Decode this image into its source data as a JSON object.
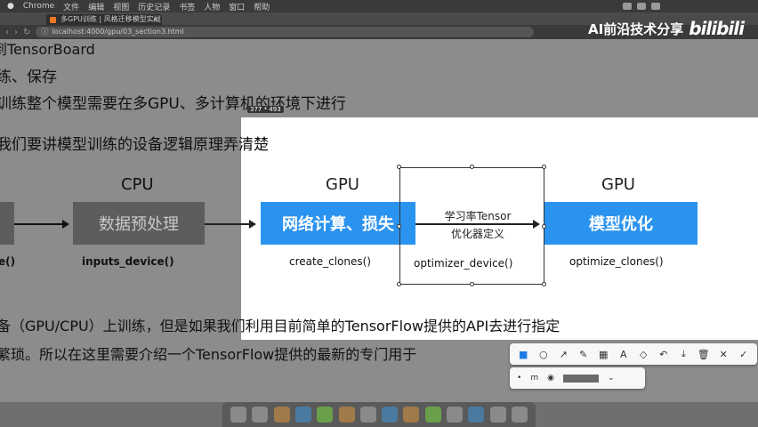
{
  "menubar": {
    "apple": "",
    "app": "Chrome",
    "items": [
      "文件",
      "编辑",
      "视图",
      "历史记录",
      "书签",
      "人物",
      "窗口",
      "帮助"
    ]
  },
  "browser": {
    "tab_title": "多GPU训练 | 风格迁移模型实战",
    "tab_close": "×",
    "back": "‹",
    "forward": "›",
    "reload": "↻",
    "url": "localhost:4000/gpu/03_section3.html"
  },
  "watermark": {
    "text": "AI前沿技术分享",
    "logo": "bilibili"
  },
  "notebook": {
    "line1": "到TensorBoard",
    "line2": "练、保存",
    "line3": "训练整个模型需要在多GPU、多计算机的环境下进行",
    "line4": "我们要讲模型训练的设备逻辑原理弄清楚",
    "line5": "备（GPU/CPU）上训练，但是如果我们利用目前简单的TensorFlow提供的API去进行指定",
    "line6": "繁琐。所以在这里需要介绍一个TensorFlow提供的最新的专门用于"
  },
  "selection": {
    "size_label": "377 * 493"
  },
  "diagram": {
    "cpu_header": "CPU",
    "gpu_header_left": "GPU",
    "gpu_header_right": "GPU",
    "box_preprocess": "数据预处理",
    "box_network": "网络计算、损失",
    "box_optimize": "模型优化",
    "mid_label_1": "学习率Tensor",
    "mid_label_2": "优化器定义",
    "fn_left_cut": "e()",
    "fn_inputs": "inputs_device()",
    "fn_create": "create_clones()",
    "fn_optimizer": "optimizer_device()",
    "fn_optimize": "optimize_clones()"
  },
  "toolbar": {
    "tools": [
      {
        "name": "rectangle-tool",
        "glyph": "■"
      },
      {
        "name": "ellipse-tool",
        "glyph": "○"
      },
      {
        "name": "arrow-tool",
        "glyph": "↗"
      },
      {
        "name": "pen-tool",
        "glyph": "✎"
      },
      {
        "name": "mosaic-tool",
        "glyph": "▦"
      },
      {
        "name": "text-tool",
        "glyph": "A"
      },
      {
        "name": "eraser-tool",
        "glyph": "◇"
      },
      {
        "name": "undo-tool",
        "glyph": "↶"
      },
      {
        "name": "download-tool",
        "glyph": "⤓"
      },
      {
        "name": "delete-tool",
        "glyph": "🗑"
      },
      {
        "name": "cancel-tool",
        "glyph": "✕"
      },
      {
        "name": "confirm-tool",
        "glyph": "✓"
      }
    ],
    "size_small": "•",
    "size_mid": "m",
    "fill_icon": "◉",
    "dropdown": "⌄"
  }
}
